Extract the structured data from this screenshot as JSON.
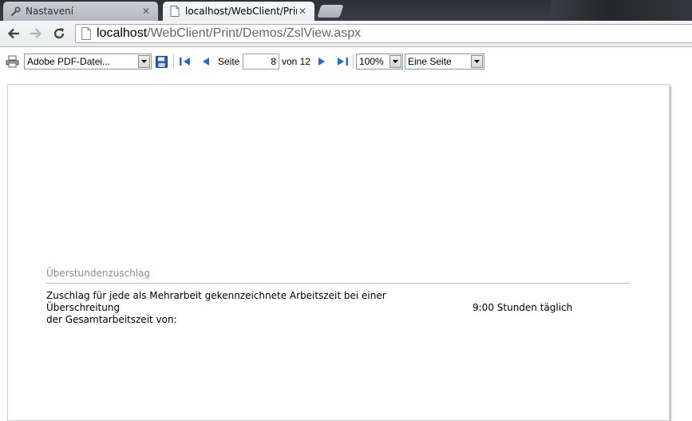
{
  "browser": {
    "tabs": [
      {
        "title": "Nastavení",
        "icon": "wrench-icon",
        "active": false
      },
      {
        "title": "localhost/WebClient/Print",
        "icon": "page-icon",
        "active": true
      }
    ],
    "address": {
      "host": "localhost",
      "path": "/WebClient/Print/Demos/ZslView.aspx"
    }
  },
  "toolbar": {
    "export_format": "Adobe PDF-Datei...",
    "page_label": "Seite",
    "current_page": "8",
    "of_label": "von 12",
    "zoom": "100%",
    "view_mode": "Eine Seite"
  },
  "report": {
    "section_title": "Überstundenzuschlag",
    "description_line1": "Zuschlag für jede als Mehrarbeit gekennzeichnete Arbeitszeit bei einer Überschreitung",
    "description_line2": "der Gesamtarbeitszeit von:",
    "value": "9:00 Stunden täglich"
  },
  "colors": {
    "nav_icon": "#1c6fd1",
    "tab_strip": "#2d3036",
    "section_title": "#8b8b8b"
  }
}
